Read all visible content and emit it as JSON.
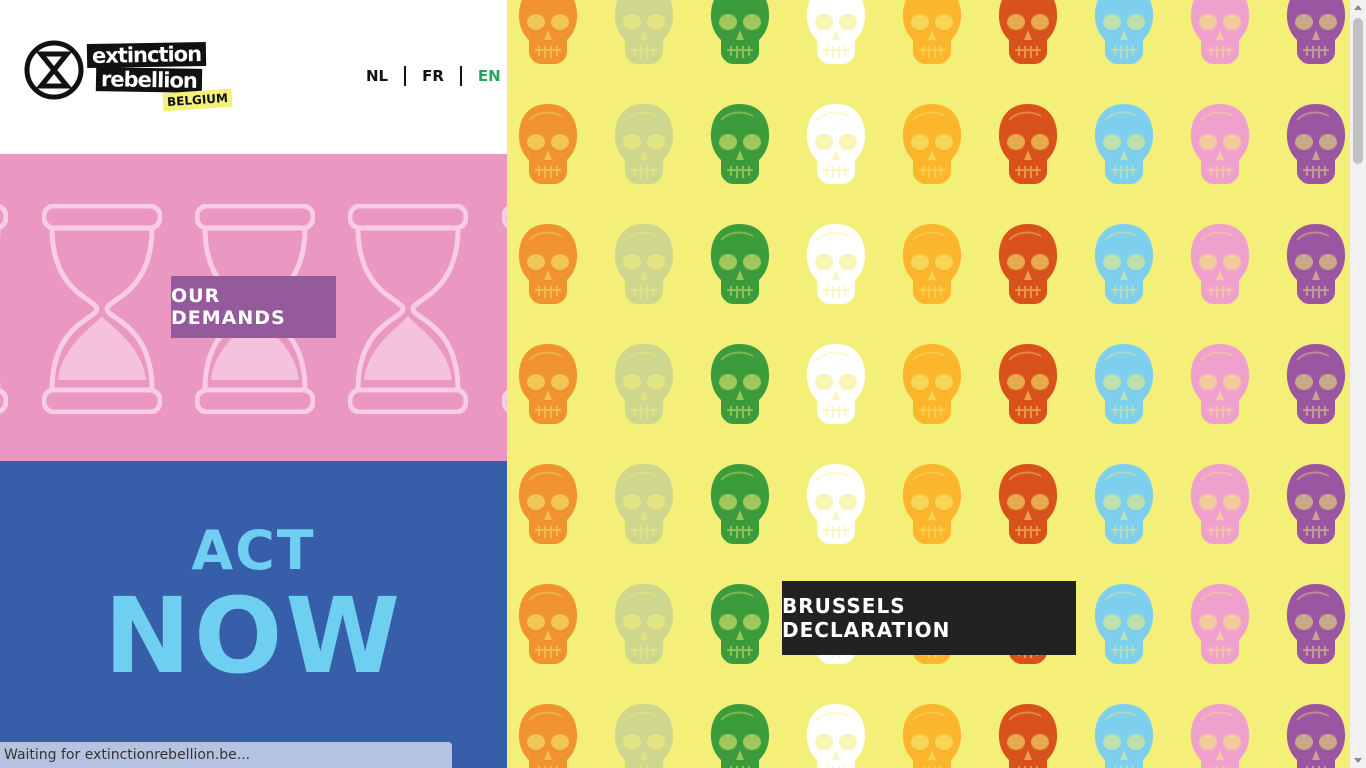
{
  "logo": {
    "line1": "extinction",
    "line2": "rebellion",
    "country": "BELGIUM"
  },
  "languages": [
    {
      "label": "NL",
      "active": false
    },
    {
      "label": "FR",
      "active": false
    },
    {
      "label": "EN",
      "active": true
    }
  ],
  "demands": {
    "button_label": "OUR DEMANDS"
  },
  "act_now": {
    "line1": "ACT",
    "line2": "NOW"
  },
  "declaration": {
    "button_label": "BRUSSELS DECLARATION"
  },
  "status_bar": {
    "text": "Waiting for extinctionrebellion.be..."
  },
  "colors": {
    "pink_panel": "#ea97c2",
    "purple_button": "#955a9c",
    "blue_panel": "#375ea8",
    "light_blue_text": "#6fcff0",
    "yellow_bg": "#f3ef78",
    "green_active": "#2aa35a",
    "dark_button": "#222222",
    "skull_palette": [
      "#f0922e",
      "#cfd68e",
      "#3c9c3c",
      "#ffffff",
      "#fbb62d",
      "#d9521c",
      "#7ecfee",
      "#f0a0cc",
      "#9a56a0"
    ]
  },
  "icons": {
    "logo": "extinction-symbol-icon",
    "demands_bg": "hourglass-icon",
    "pattern": "skull-icon"
  }
}
